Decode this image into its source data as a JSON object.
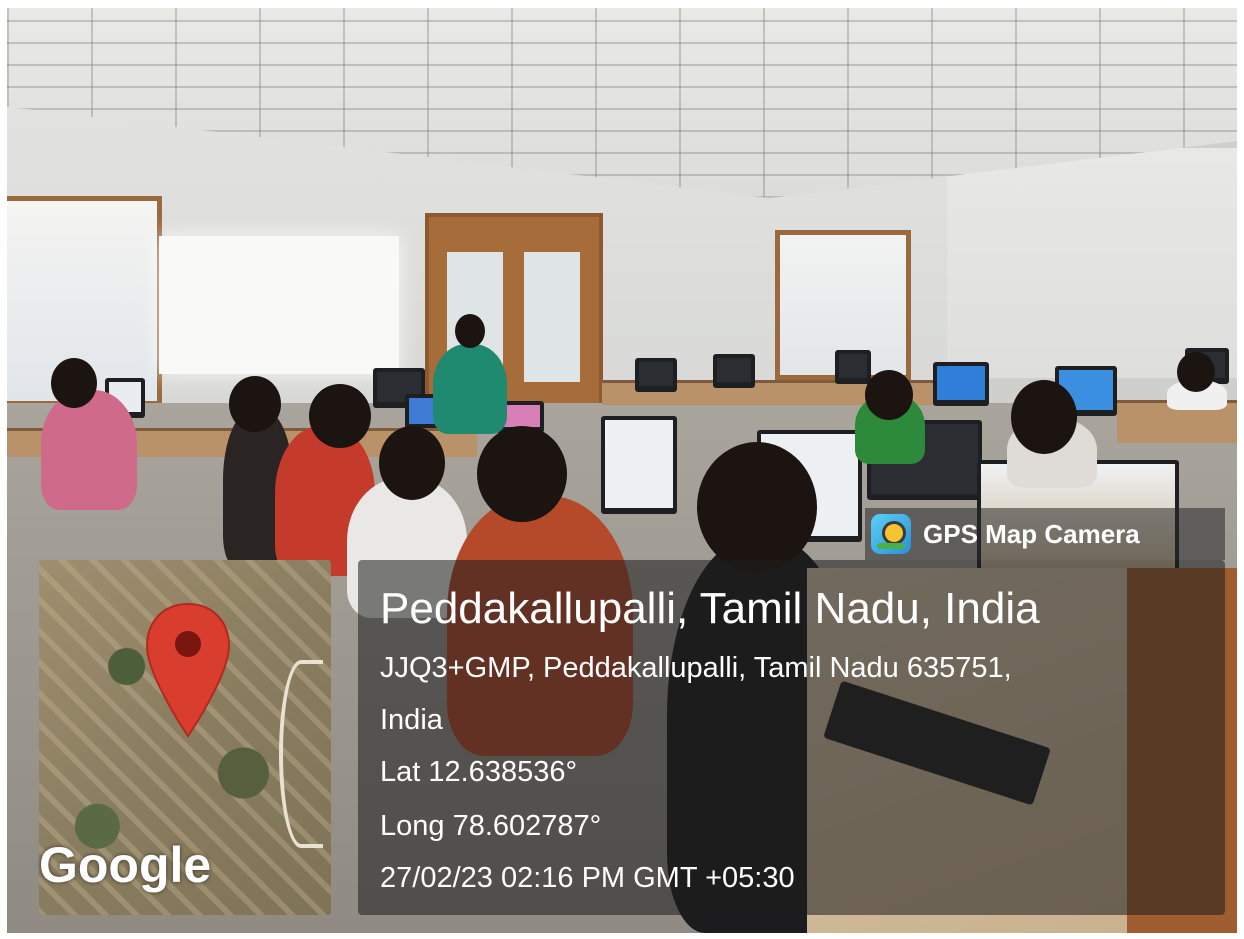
{
  "overlay": {
    "app_badge": "GPS Map Camera",
    "place_title": "Peddakallupalli, Tamil Nadu, India",
    "address_line1": "JJQ3+GMP, Peddakallupalli, Tamil Nadu 635751,",
    "address_line2": "India",
    "latitude": "Lat 12.638536°",
    "longitude": "Long 78.602787°",
    "datetime": "27/02/23 02:16 PM GMT +05:30"
  },
  "map": {
    "logo_text": "Google",
    "pin_color": "#d93d2e"
  },
  "icons": {
    "app_badge_icon": "map-pin-camera-icon",
    "map_pin_icon": "location-pin-icon"
  }
}
